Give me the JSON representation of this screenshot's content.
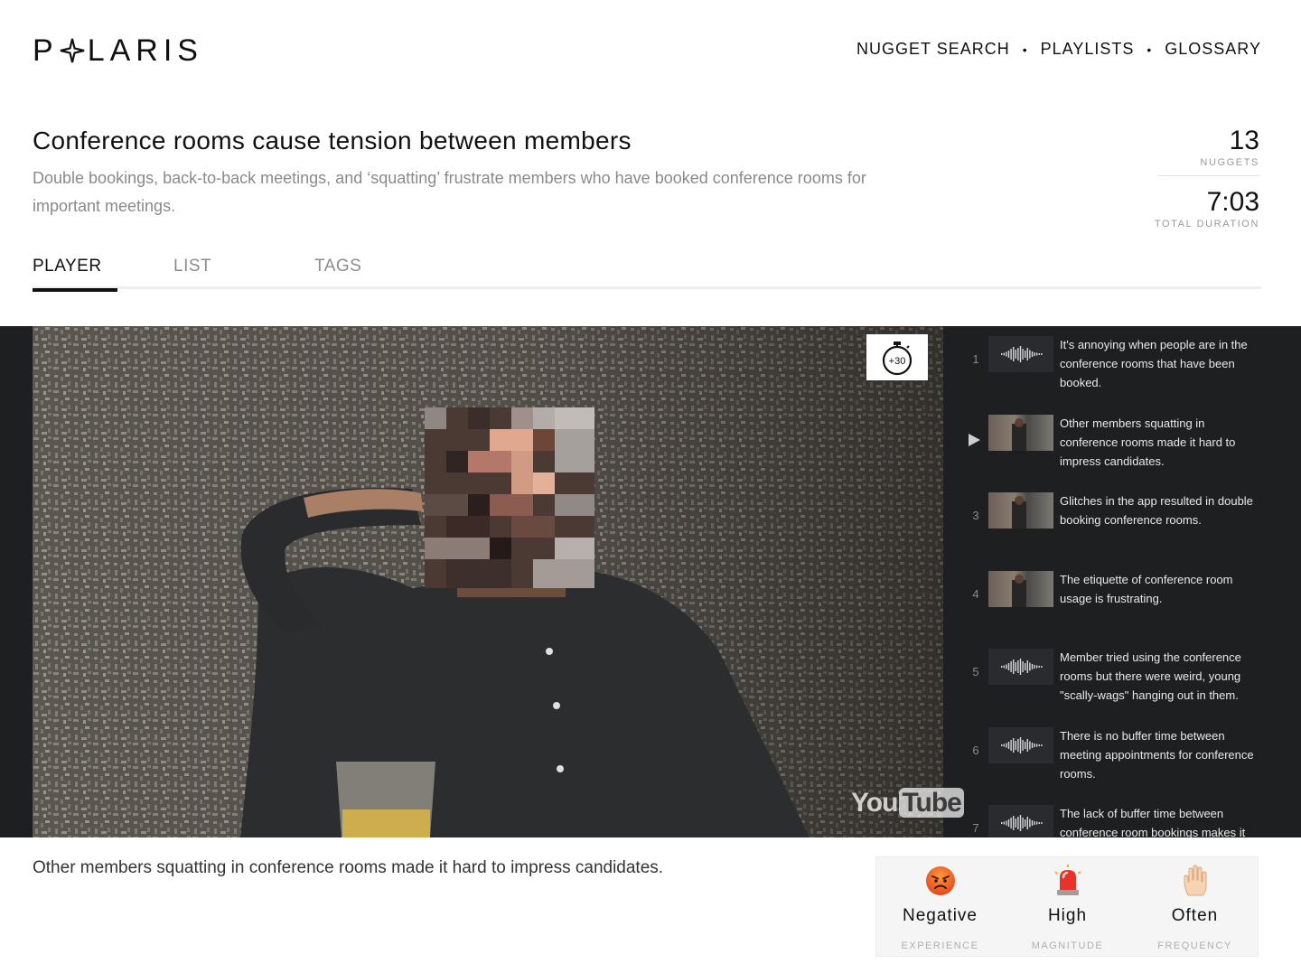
{
  "brand": {
    "logo_text": "P✦LARIS"
  },
  "nav": {
    "items": [
      "NUGGET SEARCH",
      "PLAYLISTS",
      "GLOSSARY"
    ],
    "separator": "•"
  },
  "insight": {
    "title": "Conference rooms cause tension between members",
    "description": "Double bookings, back-to-back meetings, and ‘squatting’ frustrate members who have booked conference rooms for important meetings."
  },
  "stats": {
    "nuggets_value": "13",
    "nuggets_label": "NUGGETS",
    "duration_value": "7:03",
    "duration_label": "TOTAL DURATION"
  },
  "tabs": [
    "PLAYER",
    "LIST",
    "TAGS"
  ],
  "active_tab": "PLAYER",
  "player": {
    "skip_label": "+30",
    "watermark_you": "You",
    "watermark_tube": "Tube"
  },
  "playlist": [
    {
      "index": "1",
      "text": "It's annoying when people are in the conference rooms that have been booked.",
      "thumb": "waveform-icon",
      "playing": false
    },
    {
      "index": "2",
      "text": "Other members squatting in conference rooms made it hard to impress candidates.",
      "thumb": "video-thumbnail",
      "playing": true
    },
    {
      "index": "3",
      "text": "Glitches in the app resulted in double booking conference rooms.",
      "thumb": "video-thumbnail",
      "playing": false
    },
    {
      "index": "4",
      "text": "The etiquette of conference room usage is frustrating.",
      "thumb": "video-thumbnail",
      "playing": false
    },
    {
      "index": "5",
      "text": "Member tried using the conference rooms but there were weird, young \"scally-wags\" hanging out in them.",
      "thumb": "waveform-icon",
      "playing": false
    },
    {
      "index": "6",
      "text": "There is no buffer time between meeting appointments for conference rooms.",
      "thumb": "waveform-icon",
      "playing": false
    },
    {
      "index": "7",
      "text": "The lack of buffer time between conference room bookings makes it hard to have meetings on time.",
      "thumb": "waveform-icon",
      "playing": false
    }
  ],
  "caption": "Other members squatting in conference rooms made it hard to impress candidates.",
  "rating": {
    "experience": {
      "value": "Negative",
      "label": "EXPERIENCE",
      "icon": "angry-face-icon"
    },
    "magnitude": {
      "value": "High",
      "label": "MAGNITUDE",
      "icon": "siren-icon"
    },
    "frequency": {
      "value": "Often",
      "label": "FREQUENCY",
      "icon": "raised-hand-icon"
    }
  },
  "colors": {
    "player_background": "#1e1f21",
    "accent_text": "#111111",
    "muted_text": "#8a8a8a"
  }
}
